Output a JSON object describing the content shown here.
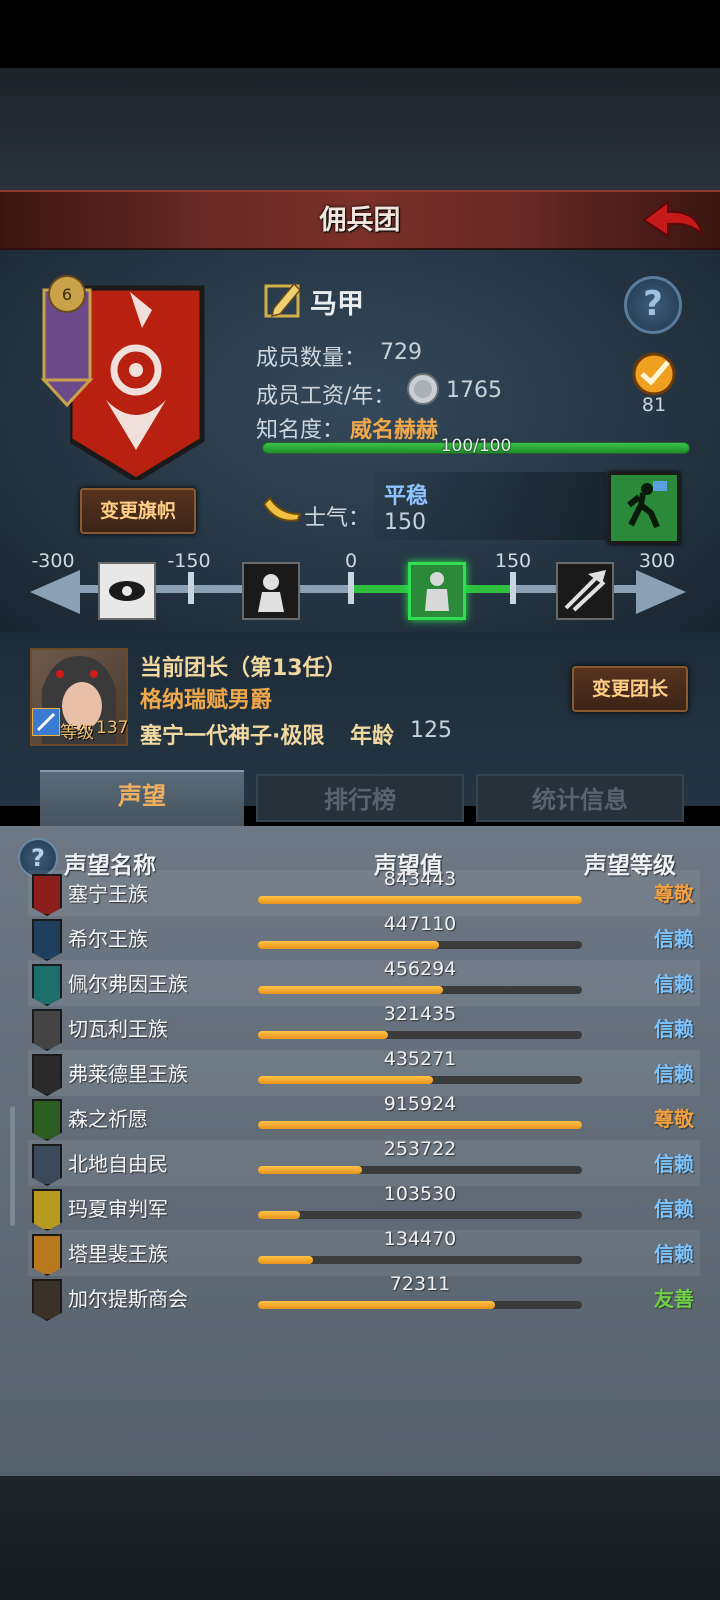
{
  "header": {
    "title": "佣兵团"
  },
  "guild": {
    "name": "马甲",
    "members_label": "成员数量：",
    "members_value": "729",
    "wage_label": "成员工资/年：",
    "wage_value": "1765",
    "fame_label": "知名度：",
    "fame_value": "威名赫赫",
    "fame_progress_text": "100/100",
    "fame_progress": 1.0,
    "rank_value": "81",
    "change_flag_label": "变更旗帜"
  },
  "morale": {
    "label": "士气：",
    "state": "平稳",
    "value": "150",
    "ticks": [
      "-300",
      "-150",
      "0",
      "150",
      "300"
    ]
  },
  "leader": {
    "title": "当前团长（第13任）",
    "name": "格纳瑞赋男爵",
    "level_label": "等级",
    "level_value": "137",
    "class_text": "塞宁一代神子·极限",
    "age_label": "年龄",
    "age_value": "125",
    "change_label": "变更团长"
  },
  "tabs": [
    "声望",
    "排行榜",
    "统计信息"
  ],
  "list": {
    "col_name": "声望名称",
    "col_value": "声望值",
    "col_level": "声望等级",
    "rows": [
      {
        "name": "塞宁王族",
        "value": "843443",
        "fill": 1.0,
        "level": "尊敬",
        "level_color": "#f0a040",
        "icon_color": "#8c1e1e"
      },
      {
        "name": "希尔王族",
        "value": "447110",
        "fill": 0.56,
        "level": "信赖",
        "level_color": "#7cc4ff",
        "icon_color": "#1f3f5c"
      },
      {
        "name": "佩尔弗因王族",
        "value": "456294",
        "fill": 0.57,
        "level": "信赖",
        "level_color": "#7cc4ff",
        "icon_color": "#1c6e6a"
      },
      {
        "name": "切瓦利王族",
        "value": "321435",
        "fill": 0.4,
        "level": "信赖",
        "level_color": "#7cc4ff",
        "icon_color": "#444444"
      },
      {
        "name": "弗莱德里王族",
        "value": "435271",
        "fill": 0.54,
        "level": "信赖",
        "level_color": "#7cc4ff",
        "icon_color": "#2a2a2a"
      },
      {
        "name": "森之祈愿",
        "value": "915924",
        "fill": 1.0,
        "level": "尊敬",
        "level_color": "#f0a040",
        "icon_color": "#2d5c22"
      },
      {
        "name": "北地自由民",
        "value": "253722",
        "fill": 0.32,
        "level": "信赖",
        "level_color": "#7cc4ff",
        "icon_color": "#3a4a5a"
      },
      {
        "name": "玛夏审判军",
        "value": "103530",
        "fill": 0.13,
        "level": "信赖",
        "level_color": "#7cc4ff",
        "icon_color": "#b89a1e"
      },
      {
        "name": "塔里裴王族",
        "value": "134470",
        "fill": 0.17,
        "level": "信赖",
        "level_color": "#7cc4ff",
        "icon_color": "#b8781e"
      },
      {
        "name": "加尔提斯商会",
        "value": "72311",
        "fill": 0.73,
        "level": "友善",
        "level_color": "#6fd04a",
        "icon_color": "#3a3228"
      }
    ]
  }
}
